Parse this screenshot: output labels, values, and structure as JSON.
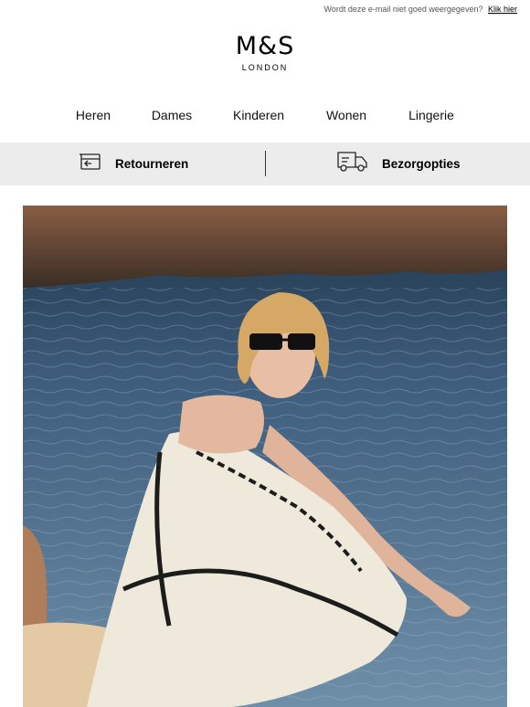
{
  "topbar": {
    "message": "Wordt deze e-mail niet goed weergegeven?",
    "link": "Klik hier"
  },
  "logo": {
    "mark": "M&S",
    "subtitle": "LONDON"
  },
  "nav": {
    "items": [
      "Heren",
      "Dames",
      "Kinderen",
      "Wonen",
      "Lingerie"
    ]
  },
  "services": {
    "returns_label": "Retourneren",
    "returns_icon": "return-box-icon",
    "delivery_label": "Bezorgopties",
    "delivery_icon": "delivery-truck-icon"
  },
  "hero": {
    "alt": "Vrouw met zonnebril in een zwart-witte jurk zittend aan het water"
  }
}
